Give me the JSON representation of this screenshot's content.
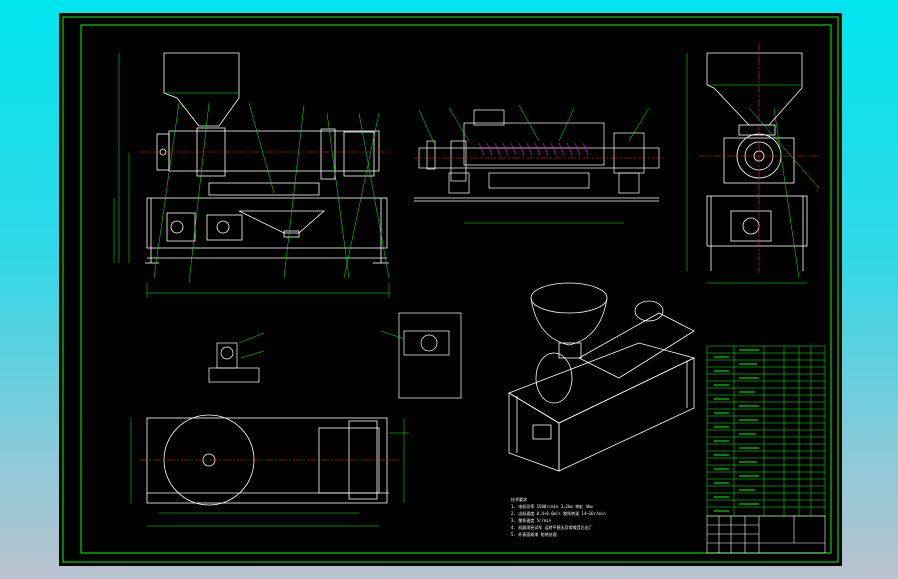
{
  "canvas_background": "#000000",
  "colors": {
    "frame": "#00ff00",
    "outline": "#ffffff",
    "centerline": "#ff2020",
    "leaders": "#00ff00",
    "dimensions": "#00ff00",
    "section_hatch": "#ff00ff",
    "table_text": "#00ff00",
    "background_gradient_top": "#00e5ee",
    "background_gradient_bottom": "#b9c2cf"
  },
  "notes": [
    "技术要求",
    "1. 电机功率 1500r/min 3.2kw 单缸 4kw",
    "2. 出料速度 0.4~0.6m/s 搅拌转速 14~16r/min",
    "3. 搅拌速度 5r/min",
    "4. 机器须经试车 运转平稳无异常噪音后出厂",
    "5. 外表面刷漆 防锈处理"
  ],
  "title_block": {
    "name": "",
    "drawing_no": ""
  }
}
